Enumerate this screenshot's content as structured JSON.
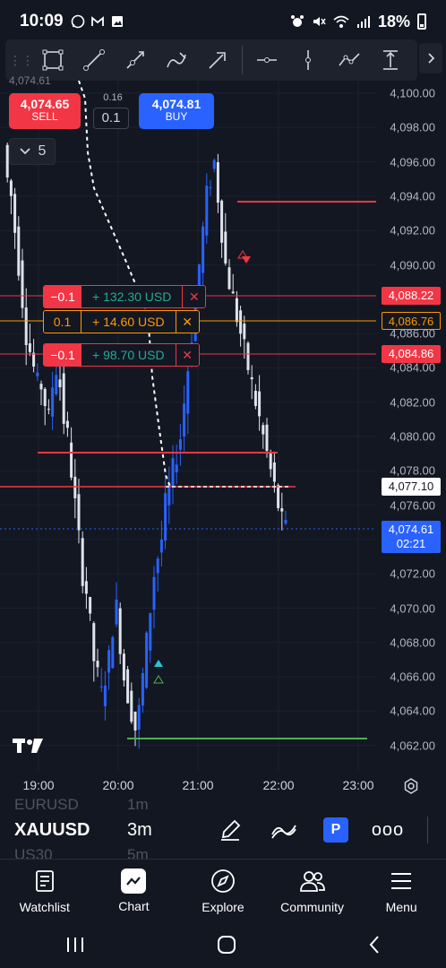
{
  "status_bar": {
    "time": "10:09",
    "battery": "18%"
  },
  "trade_panel": {
    "sell_price": "4,074.65",
    "sell_label": "SELL",
    "spread": "0.16",
    "quantity": "0.1",
    "buy_price": "4,074.81",
    "buy_label": "BUY",
    "intervals_count": "5"
  },
  "top_partial_label": "4,074.61",
  "price_axis": [
    "4,100.00",
    "4,098.00",
    "4,096.00",
    "4,094.00",
    "4,092.00",
    "4,090.00",
    "4,086.00",
    "4,084.00",
    "4,082.00",
    "4,080.00",
    "4,078.00",
    "4,076.00",
    "4,072.00",
    "4,070.00",
    "4,068.00",
    "4,066.00",
    "4,064.00",
    "4,062.00"
  ],
  "orders": [
    {
      "qty": "−0.1",
      "pnl": "+ 132.30 USD",
      "price": "4,088.22",
      "color": "#f23645"
    },
    {
      "qty": "0.1",
      "pnl": "+ 14.60 USD",
      "price": "4,086.76",
      "color": "#ff9800"
    },
    {
      "qty": "−0.1",
      "pnl": "+ 98.70 USD",
      "price": "4,084.86",
      "color": "#f23645"
    }
  ],
  "markers": {
    "last_price_white": "4,077.10",
    "current_price": "4,074.61",
    "countdown": "02:21"
  },
  "time_axis": [
    "19:00",
    "20:00",
    "21:00",
    "22:00",
    "23:00"
  ],
  "symbol_bar": {
    "ghost_symbol_top": "EURUSD",
    "ghost_interval_top": "1m",
    "symbol": "XAUUSD",
    "interval": "3m",
    "ghost_symbol_bottom": "US30",
    "ghost_interval_bottom": "5m"
  },
  "bottom_nav": [
    {
      "label": "Watchlist",
      "icon": "watchlist-icon"
    },
    {
      "label": "Chart",
      "icon": "chart-icon"
    },
    {
      "label": "Explore",
      "icon": "compass-icon"
    },
    {
      "label": "Community",
      "icon": "community-icon"
    },
    {
      "label": "Menu",
      "icon": "menu-icon"
    }
  ],
  "colors": {
    "background": "#131722",
    "bull": "#2962ff",
    "bear": "#ffffff",
    "sell": "#f23645",
    "buy": "#2962ff",
    "pending": "#ff9800",
    "support": "#4caf50"
  }
}
